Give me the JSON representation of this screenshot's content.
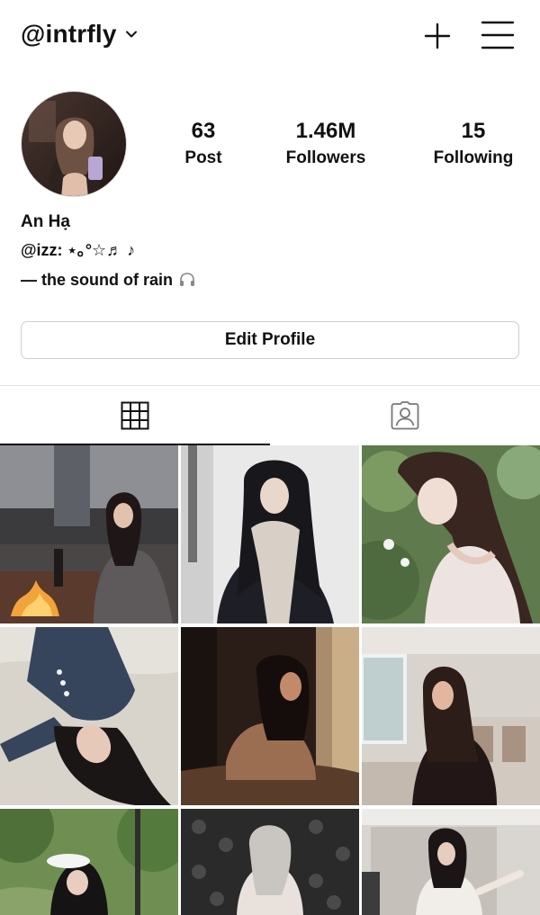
{
  "header": {
    "username": "@intrfly",
    "icons": {
      "dropdown": "chevron-down-icon",
      "add": "plus-icon",
      "menu": "hamburger-menu-icon"
    }
  },
  "profile": {
    "avatar_icon": "profile-photo",
    "stats": [
      {
        "value": "63",
        "label": "Post"
      },
      {
        "value": "1.46M",
        "label": "Followers"
      },
      {
        "value": "15",
        "label": "Following"
      }
    ],
    "name": "An Hạ",
    "bio_lines": [
      "@izz: ⋆｡°☆♬ ♪",
      "— the sound of rain"
    ],
    "bio_icon": "headphones-icon",
    "edit_button_label": "Edit Profile"
  },
  "tabs": [
    {
      "icon": "grid-icon",
      "active": true
    },
    {
      "icon": "tagged-user-icon",
      "active": false
    }
  ],
  "posts": [
    {
      "id": 1,
      "icon": "photo-thumbnail"
    },
    {
      "id": 2,
      "icon": "photo-thumbnail"
    },
    {
      "id": 3,
      "icon": "photo-thumbnail"
    },
    {
      "id": 4,
      "icon": "photo-thumbnail"
    },
    {
      "id": 5,
      "icon": "photo-thumbnail"
    },
    {
      "id": 6,
      "icon": "photo-thumbnail"
    },
    {
      "id": 7,
      "icon": "photo-thumbnail"
    },
    {
      "id": 8,
      "icon": "photo-thumbnail"
    },
    {
      "id": 9,
      "icon": "photo-thumbnail"
    }
  ],
  "colors": {
    "text": "#111111",
    "border": "#cfcfcf",
    "divider": "#e4e4e4",
    "background": "#ffffff"
  }
}
